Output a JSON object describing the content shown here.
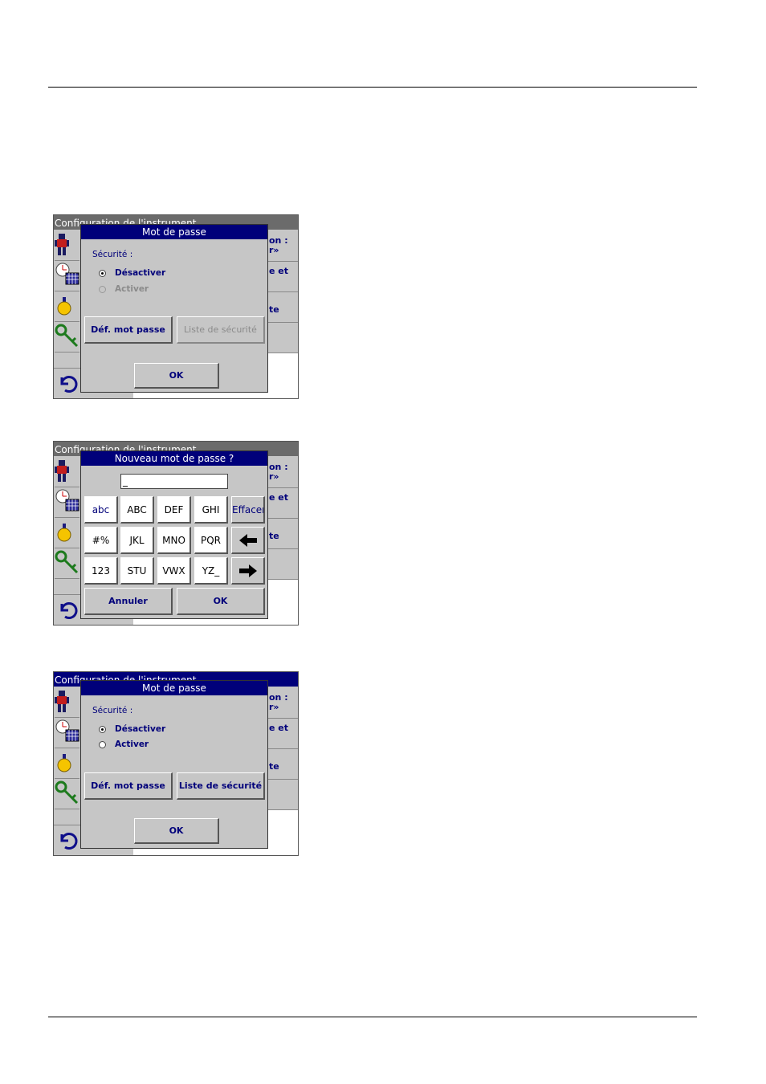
{
  "screens": [
    {
      "app_title": "Configuration de l'instrument",
      "right_items": [
        "on :",
        "r»",
        "e et",
        "",
        "te",
        ""
      ],
      "dialog": {
        "title": "Mot de passe",
        "security_label": "Sécurité :",
        "option_disable": "Désactiver",
        "option_enable": "Activer",
        "set_password_button": "Déf. mot passe",
        "security_list_button": "Liste de sécurité",
        "ok_button": "OK"
      }
    },
    {
      "app_title": "Configuration de l'instrument",
      "right_items": [
        "on :",
        "r»",
        "e et",
        "",
        "te",
        ""
      ],
      "dialog": {
        "title": "Nouveau mot de passe ?",
        "input_value": "_",
        "keys_row1": [
          "abc",
          "ABC",
          "DEF",
          "GHI",
          "Effacer"
        ],
        "keys_row2": [
          "#%",
          "JKL",
          "MNO",
          "PQR",
          "←"
        ],
        "keys_row3": [
          "123",
          "STU",
          "VWX",
          "YZ_",
          "→"
        ],
        "cancel_button": "Annuler",
        "ok_button": "OK"
      }
    },
    {
      "app_title": "Configuration de l'instrument",
      "right_items": [
        "on :",
        "r»",
        "e et",
        "",
        "te",
        ""
      ],
      "dialog": {
        "title": "Mot de passe",
        "security_label": "Sécurité :",
        "option_disable": "Désactiver",
        "option_enable": "Activer",
        "set_password_button": "Déf. mot passe",
        "security_list_button": "Liste de sécurité",
        "ok_button": "OK"
      }
    }
  ],
  "icons": [
    "user-icon",
    "clock-calendar-icon",
    "lamp-icon",
    "key-icon",
    "back-arrow-icon",
    "arrow-left-icon",
    "arrow-right-icon"
  ],
  "colors": {
    "title_bar": "#00007a",
    "dialog_bg": "#c6c6c6",
    "text_blue": "#00007a",
    "disabled": "#8a8a8a"
  }
}
